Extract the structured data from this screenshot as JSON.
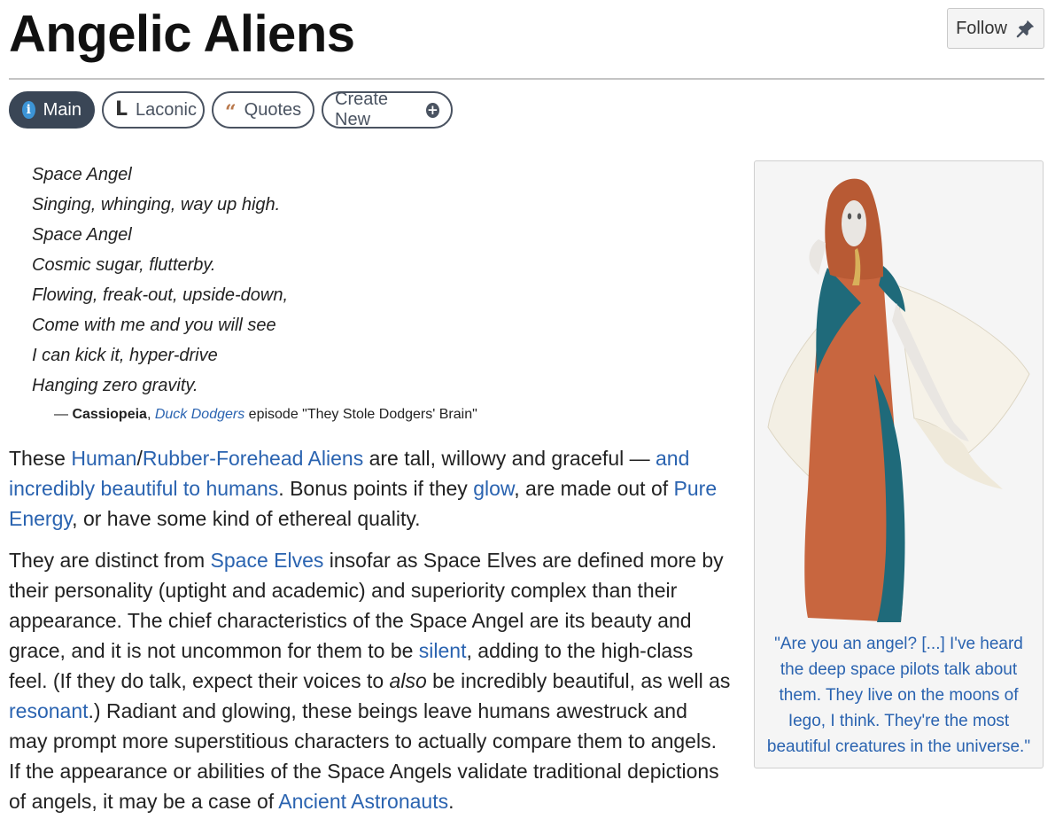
{
  "page": {
    "title": "Angelic Aliens"
  },
  "header": {
    "follow_label": "Follow",
    "follow_icon": "pin-icon"
  },
  "tabs": [
    {
      "label": "Main",
      "icon": "info-icon",
      "active": true
    },
    {
      "label": "Laconic",
      "icon": "laconic-l-icon",
      "active": false
    },
    {
      "label": "Quotes",
      "icon": "quote-marks-icon",
      "active": false
    },
    {
      "label": "Create New",
      "icon": "plus-circle-icon",
      "active": false
    }
  ],
  "quote": {
    "lines": [
      "Space Angel",
      "Singing, whinging, way up high.",
      "Space Angel",
      "Cosmic sugar, flutterby.",
      "Flowing, freak-out, upside-down,",
      "Come with me and you will see",
      "I can kick it, hyper-drive",
      "Hanging zero gravity."
    ],
    "attribution": {
      "dash": "—",
      "speaker": "Cassiopeia",
      "sep": ",",
      "work": "Duck Dodgers",
      "rest": "episode \"They Stole Dodgers' Brain\""
    }
  },
  "paragraph1": {
    "t1": "These ",
    "l1": "Human",
    "t2": "/",
    "l2": "Rubber-Forehead Aliens",
    "t3": " are tall, willowy and graceful — ",
    "l3": "and incredibly beautiful to humans",
    "t4": ". Bonus points if they ",
    "l4": "glow",
    "t5": ", are made out of ",
    "l5": "Pure Energy",
    "t6": ", or have some kind of ethereal quality."
  },
  "paragraph2": {
    "t1": "They are distinct from ",
    "l1": "Space Elves",
    "t2": " insofar as Space Elves are defined more by their personality (uptight and academic) and superiority complex than their appearance. The chief characteristics of the Space Angel are its beauty and grace, and it is not uncommon for them to be ",
    "l2": "silent",
    "t3": ", adding to the high-class feel. (If they do talk, expect their voices to ",
    "em": "also",
    "t4": " be incredibly beautiful, as well as ",
    "l3": "resonant",
    "t5": ".) Radiant and glowing, these beings leave humans awestruck and may prompt more superstitious characters to actually compare them to angels. If the appearance or abilities of the Space Angels validate traditional depictions of angels, it may be a case of ",
    "l4": "Ancient Astronauts",
    "t6": "."
  },
  "sidebar": {
    "caption": "\"Are you an angel? [...] I've heard the deep space pilots talk about them. They live on the moons of Iego, I think. They're the most beautiful creatures in the universe.\""
  },
  "colors": {
    "link": "#2a63b0",
    "tab_active": "#3a4656",
    "info_icon": "#3c94d6",
    "robe": "#c8663f",
    "robe_panel": "#1f6a7a"
  }
}
